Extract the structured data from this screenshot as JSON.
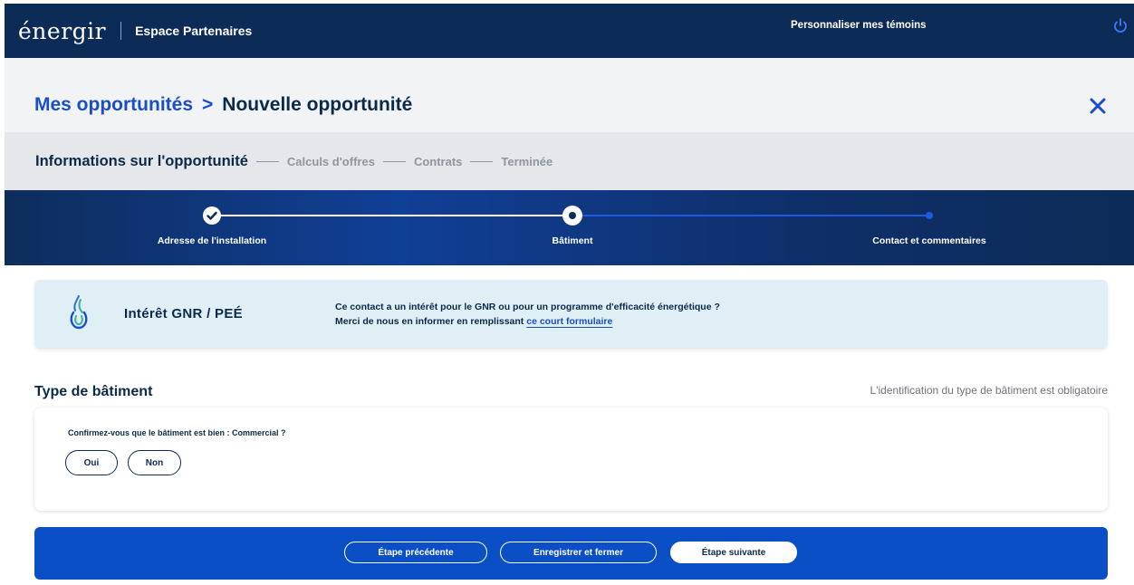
{
  "header": {
    "logo": "énergir",
    "space_title": "Espace Partenaires",
    "customize_link": "Personnaliser mes témoins"
  },
  "breadcrumb": {
    "parent": "Mes opportunités",
    "separator": ">",
    "current": "Nouvelle opportunité"
  },
  "steps": {
    "active": "Informations sur l'opportunité",
    "items": [
      "Calculs d'offres",
      "Contrats",
      "Terminée"
    ]
  },
  "progress": {
    "labels": [
      "Adresse de l'installation",
      "Bâtiment",
      "Contact et commentaires"
    ]
  },
  "info_card": {
    "title": "Intérêt GNR / PEÉ",
    "line1": "Ce contact a un intérêt pour le GNR ou pour un programme d'efficacité énergétique ?",
    "line2": "Merci de nous en informer en remplissant",
    "link": "ce court formulaire"
  },
  "building_type": {
    "title": "Type de bâtiment",
    "required_note": "L'identification du type de bâtiment est obligatoire",
    "question": "Confirmez-vous que le bâtiment est bien : Commercial ?",
    "yes_label": "Oui",
    "no_label": "Non"
  },
  "footer": {
    "previous_label": "Étape précédente",
    "save_close_label": "Enregistrer et fermer",
    "next_label": "Étape suivante"
  },
  "colors": {
    "navy": "#0d2b57",
    "brand_blue": "#0b4fc6",
    "link_blue": "#1a4ec9",
    "info_bg": "#e0eef5"
  }
}
